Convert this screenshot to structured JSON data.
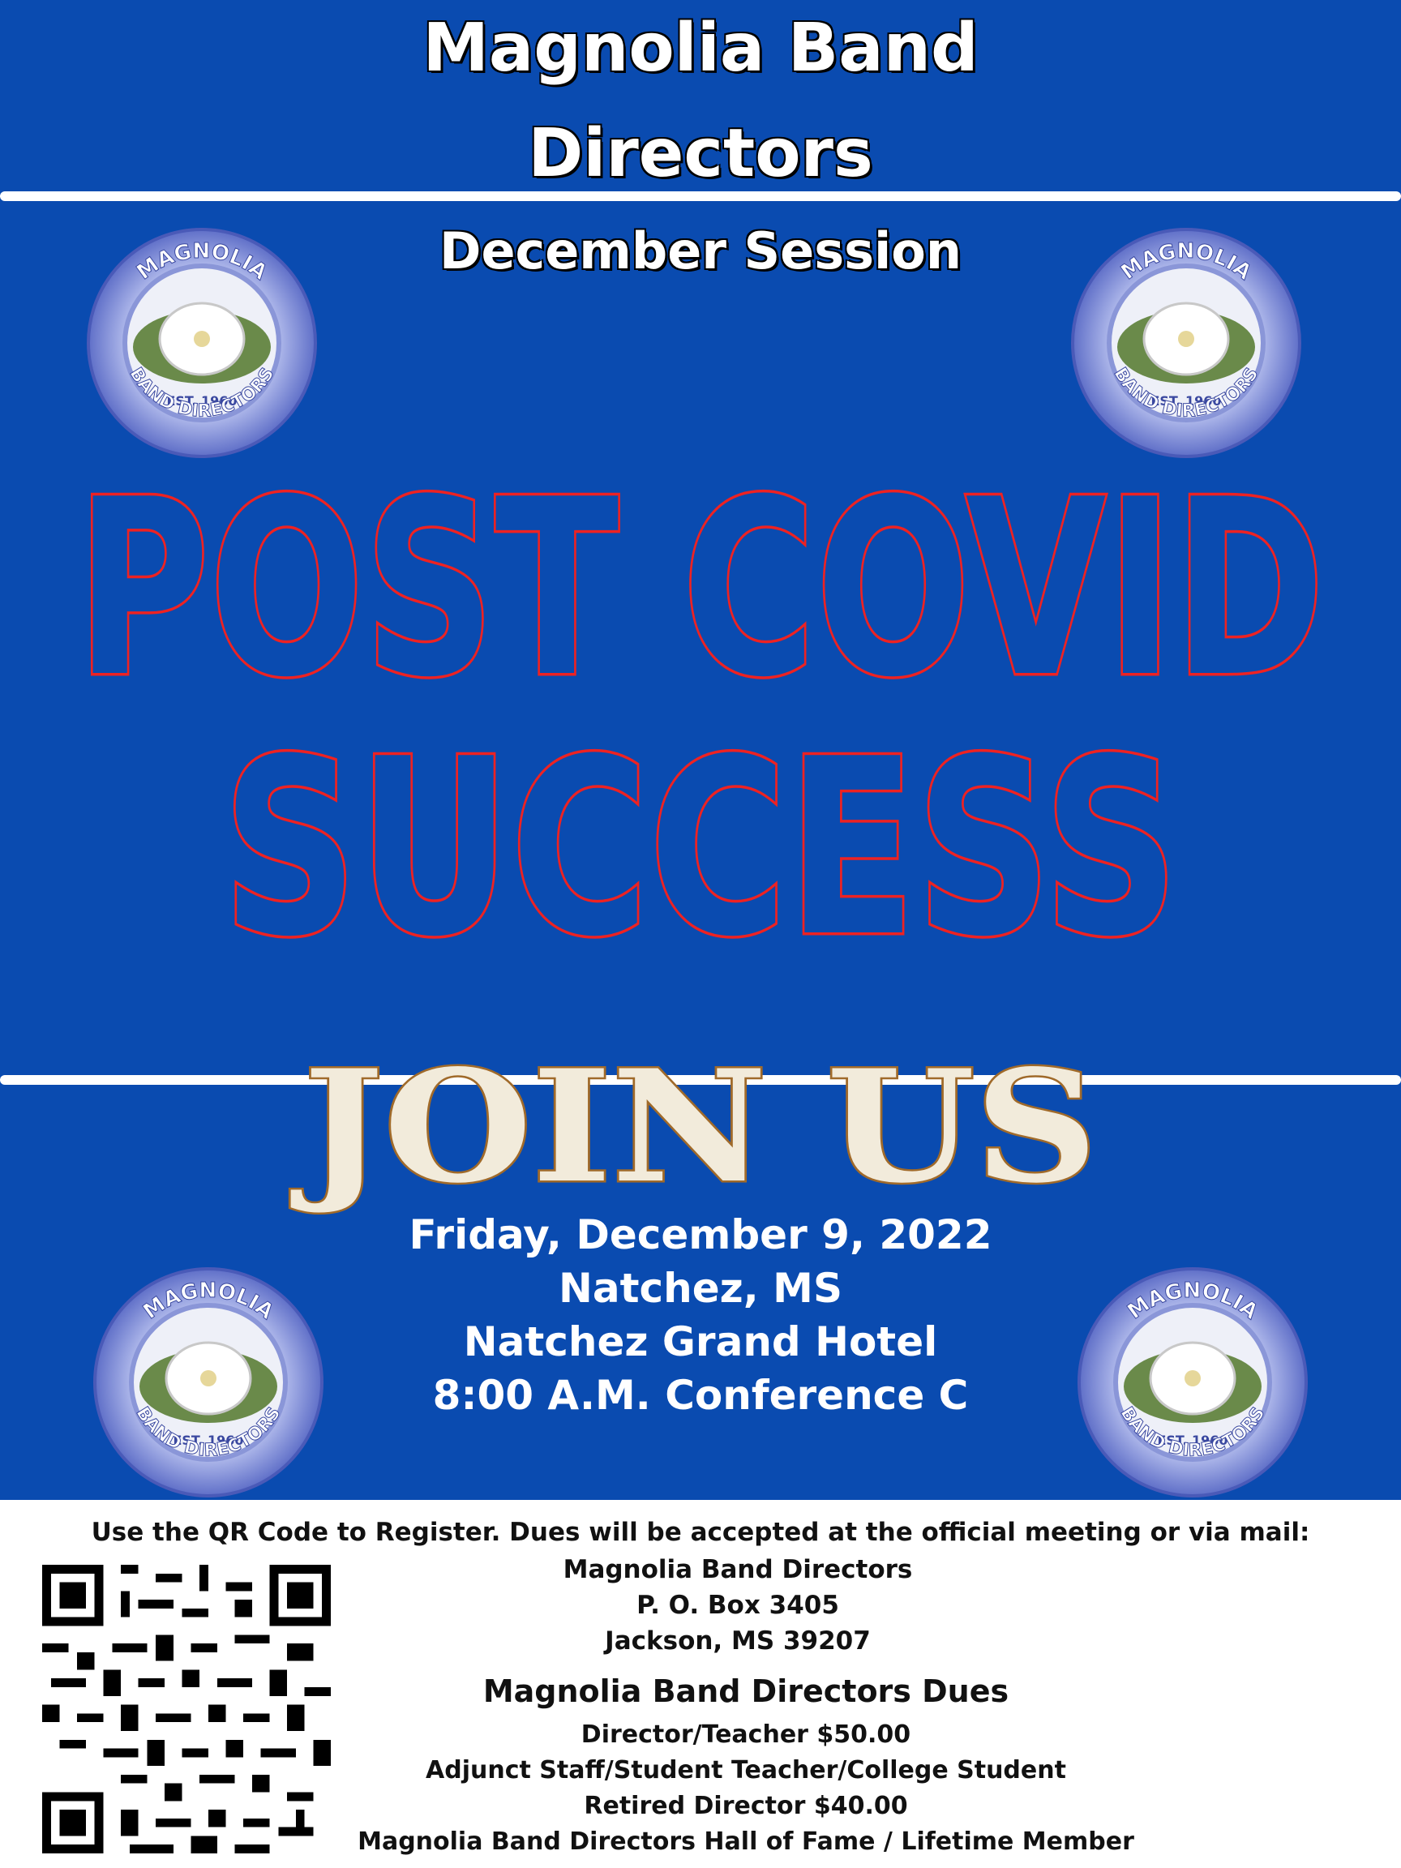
{
  "header": {
    "title_line1": "Magnolia Band",
    "title_line2": "Directors",
    "session": "December Session"
  },
  "headline": {
    "line1": "POST COVID",
    "line2": "SUCCESS",
    "cta": "JOIN US"
  },
  "logo": {
    "top_text": "MAGNOLIA",
    "est_text": "EST. 1960",
    "bottom_text": "BAND DIRECTORS"
  },
  "event": {
    "date": "Friday, December 9, 2022",
    "city": "Natchez, MS",
    "venue": "Natchez Grand Hotel",
    "time_room": "8:00 A.M.  Conference C"
  },
  "registration": {
    "instructions": "Use the QR Code to Register. Dues will be accepted at the official meeting or via mail:",
    "address": [
      "Magnolia Band Directors",
      "P. O. Box 3405",
      "Jackson, MS 39207"
    ]
  },
  "dues": {
    "title": "Magnolia Band Directors Dues",
    "items": [
      "Director/Teacher $50.00",
      "Adjunct Staff/Student Teacher/College Student",
      "Retired Director $40.00",
      "Magnolia Band Directors Hall of Fame / Lifetime Member"
    ]
  },
  "colors": {
    "background_blue": "#0a4bb0",
    "headline_outline_red": "#ee2222",
    "join_us_cream": "#f2ebdb",
    "join_us_outline": "#a06a2a"
  }
}
